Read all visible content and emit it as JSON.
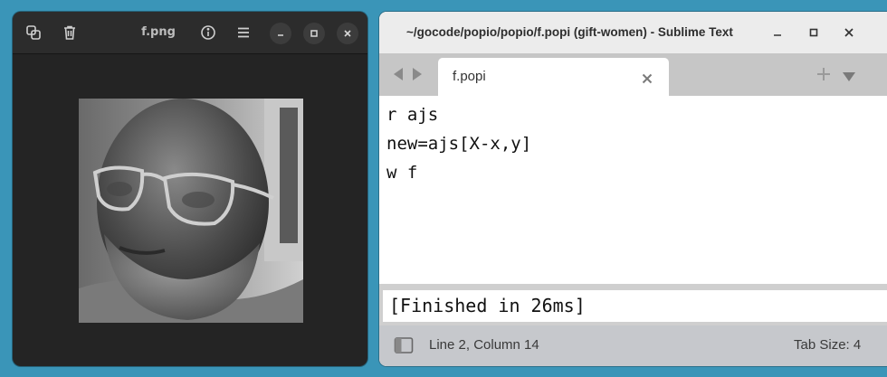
{
  "viewer": {
    "title": "f.png",
    "icons": {
      "copy": "copy-icon",
      "delete": "trash-icon",
      "info": "info-icon",
      "menu": "hamburger-menu-icon",
      "minimize": "minimize-icon",
      "maximize": "maximize-icon",
      "close": "close-icon"
    },
    "image": {
      "subject": "Grayscale portrait photo of a bald man with glasses and a gray beard"
    }
  },
  "sublime": {
    "title": "~/gocode/popio/popio/f.popi (gift-women) - Sublime Text",
    "tab_label": "f.popi",
    "editor_lines": [
      "r ajs",
      "new=ajs[X-x,y]",
      "w f"
    ],
    "output_text": "[Finished in 26ms]",
    "status": {
      "position": "Line 2, Column 14",
      "tab_size": "Tab Size: 4"
    },
    "icons": {
      "minimize": "minimize-icon",
      "maximize": "maximize-icon",
      "close": "close-icon",
      "nav_left": "arrow-left-icon",
      "nav_right": "arrow-right-icon",
      "new_tab": "plus-icon",
      "tab_list": "dropdown-triangle-icon",
      "tab_close": "close-icon",
      "sidebar_toggle": "sidebar-toggle-icon"
    }
  },
  "colors": {
    "desktop": "#3a95b8",
    "viewer_bg": "#242424",
    "sublime_tabbar": "#c6c6c6",
    "sublime_status": "#c6c8cc"
  }
}
